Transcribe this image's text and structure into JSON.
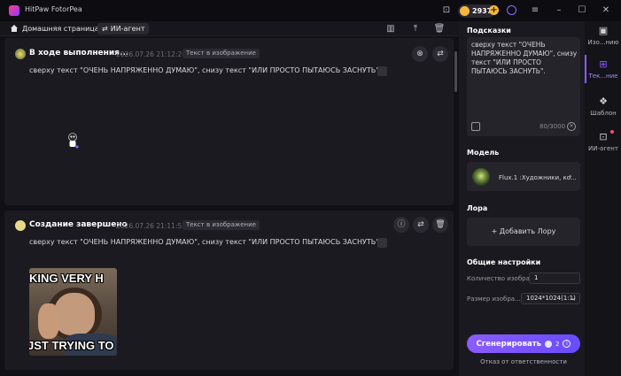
{
  "app": {
    "title": "HitPaw FotorPea",
    "credits": "2937"
  },
  "nav": {
    "home_label": "Домашняя страница",
    "agent_tab_label": "ИИ-агент"
  },
  "cards": [
    {
      "title": "В ходе выполнения...",
      "time": "2026.07.26 21:12:26",
      "tag": "Текст в изображение",
      "prompt": "сверху текст \"ОЧЕНЬ НАПРЯЖЕННО ДУМАЮ\", снизу текст \"ИЛИ ПРОСТО ПЫТАЮСЬ ЗАСНУТЬ\"."
    },
    {
      "title": "Создание завершено",
      "time": "2026.07.26 21:11:55",
      "tag": "Текст в изображение",
      "prompt": "сверху текст \"ОЧЕНЬ НАПРЯЖЕННО ДУМАЮ\", снизу текст \"ИЛИ ПРОСТО ПЫТАЮСЬ ЗАСНУТЬ\".",
      "image_top_text": "KING VERY H",
      "image_bottom_text": "JST TRYING TO S"
    }
  ],
  "panel": {
    "prompt_heading": "Подсказки",
    "prompt_text": "сверху текст \"ОЧЕНЬ НАПРЯЖЕННО ДУМАЮ\", снизу текст \"ИЛИ ПРОСТО ПЫТАЮСЬ ЗАСНУТЬ\".",
    "prompt_count": "80/3000",
    "model_heading": "Модель",
    "model_name": "Flux.1 :Художники, ко...",
    "lora_heading": "Лора",
    "lora_add_label": "+ Добавить Лору",
    "settings_heading": "Общие настройки",
    "count_label": "Количество изобра...",
    "count_value": "1",
    "size_label": "Размер изобра...",
    "size_value": "1024*1024(1:1)",
    "generate_label": "Сгенерировать",
    "generate_cost": "2",
    "disclaimer": "Отказ от ответственности"
  },
  "sidenav": [
    {
      "label": "Изо...нию",
      "icon": "image-icon"
    },
    {
      "label": "Тек...ние",
      "icon": "text-to-image-icon",
      "active": true
    },
    {
      "label": "Шаблон",
      "icon": "template-icon"
    },
    {
      "label": "ИИ-агент",
      "icon": "ai-agent-icon"
    }
  ],
  "colors": {
    "accent": "#8b5cff",
    "coin": "#f6b73c",
    "background": "#111016",
    "panel": "#1a1920"
  }
}
